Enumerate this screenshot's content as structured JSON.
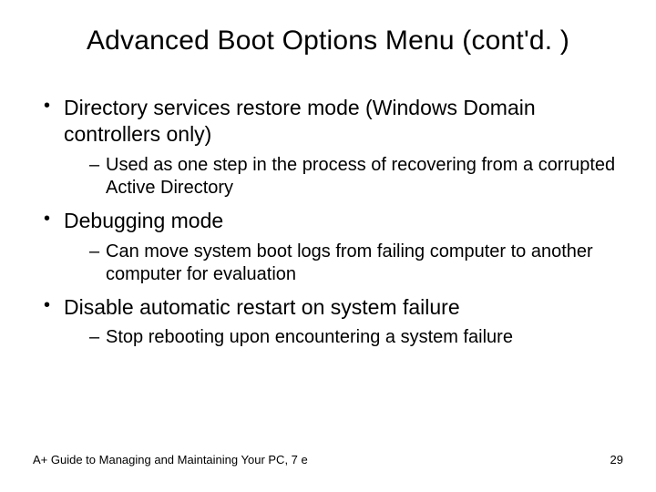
{
  "title": "Advanced Boot Options Menu (cont'd. )",
  "bullets": [
    {
      "text": "Directory services restore mode (Windows Domain controllers only)",
      "sub": [
        "Used as one step in the process of recovering from a corrupted Active Directory"
      ]
    },
    {
      "text": "Debugging mode",
      "sub": [
        "Can move system boot logs from failing computer to another computer for evaluation"
      ]
    },
    {
      "text": "Disable automatic restart on system failure",
      "sub": [
        "Stop rebooting upon encountering a system failure"
      ]
    }
  ],
  "footer": {
    "left": "A+ Guide to Managing and Maintaining Your PC, 7 e",
    "right": "29"
  }
}
